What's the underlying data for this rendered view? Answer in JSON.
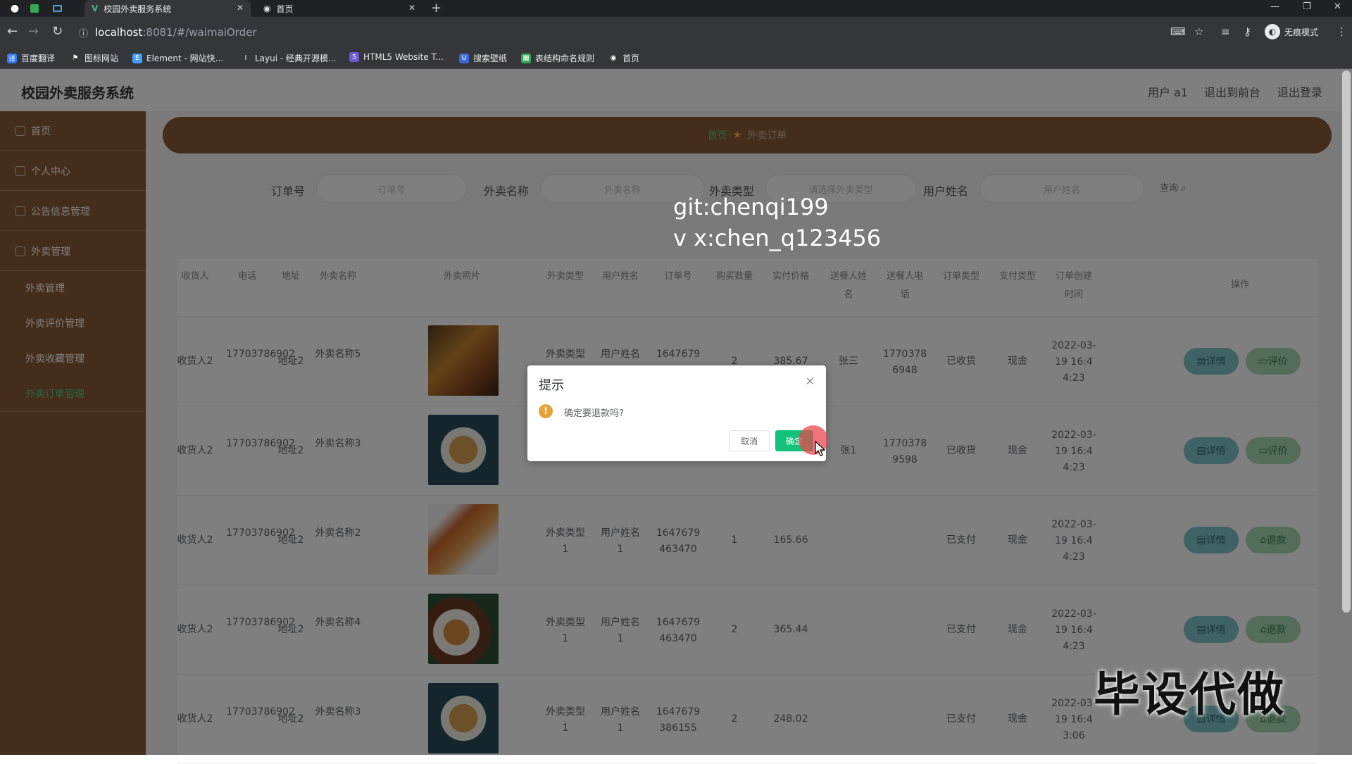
{
  "browser": {
    "tabs": [
      {
        "title": "校园外卖服务系统",
        "active": true
      },
      {
        "title": "首页",
        "active": false
      }
    ],
    "url_host": "localhost",
    "url_path": ":8081/#/waimaiOrder",
    "incognito_label": "无痕模式",
    "bookmarks": [
      "百度翻译",
      "图标网站",
      "Element - 网站快...",
      "Layui - 经典开源模...",
      "HTML5 Website T...",
      "搜索壁纸",
      "表结构命名规则",
      "首页"
    ]
  },
  "app": {
    "title": "校园外卖服务系统",
    "header_links": [
      "用户 a1",
      "退出到前台",
      "退出登录"
    ]
  },
  "sidebar": {
    "items": [
      "首页",
      "个人中心",
      "公告信息管理",
      "外卖管理"
    ],
    "subitems": [
      "外卖管理",
      "外卖评价管理",
      "外卖收藏管理",
      "外卖订单管理"
    ]
  },
  "breadcrumb": {
    "home": "首页",
    "current": "外卖订单"
  },
  "search": {
    "labels": [
      "订单号",
      "外卖名称",
      "外卖类型",
      "用户姓名"
    ],
    "placeholders": [
      "订单号",
      "外卖名称",
      "请选择外卖类型",
      "用户姓名"
    ],
    "button": "查询"
  },
  "table": {
    "headers": [
      "收货人",
      "电话",
      "地址",
      "外卖名称",
      "外卖照片",
      "外卖类型",
      "用户姓名",
      "订单号",
      "购买数量",
      "实付价格",
      "送餐人姓名",
      "送餐人电话",
      "订单类型",
      "支付类型",
      "订单创建时间",
      "操作"
    ],
    "rows": [
      {
        "receiver": "收货人2",
        "phone": "17703786902",
        "address": "地址2",
        "name": "外卖名称5",
        "type": "外卖类型1",
        "user": "用户姓名1",
        "order_no": "1647679463470",
        "qty": "2",
        "price": "385.67",
        "courier": "张三",
        "courier_phone": "17703786948",
        "status": "已收货",
        "pay": "现金",
        "time": "2022-03-19 16:44:23",
        "action": "评价"
      },
      {
        "receiver": "收货人2",
        "phone": "17703786902",
        "address": "地址2",
        "name": "外卖名称3",
        "type": "",
        "user": "",
        "order_no": "",
        "qty": "",
        "price": "",
        "courier": "张1",
        "courier_phone": "17703789598",
        "status": "已收货",
        "pay": "现金",
        "time": "2022-03-19 16:44:23",
        "action": "评价"
      },
      {
        "receiver": "收货人2",
        "phone": "17703786902",
        "address": "地址2",
        "name": "外卖名称2",
        "type": "外卖类型1",
        "user": "用户姓名1",
        "order_no": "1647679463470",
        "qty": "1",
        "price": "165.66",
        "courier": "",
        "courier_phone": "",
        "status": "已支付",
        "pay": "现金",
        "time": "2022-03-19 16:44:23",
        "action": "退款"
      },
      {
        "receiver": "收货人2",
        "phone": "17703786902",
        "address": "地址2",
        "name": "外卖名称4",
        "type": "外卖类型1",
        "user": "用户姓名1",
        "order_no": "1647679463470",
        "qty": "2",
        "price": "365.44",
        "courier": "",
        "courier_phone": "",
        "status": "已支付",
        "pay": "现金",
        "time": "2022-03-19 16:44:23",
        "action": "退款"
      },
      {
        "receiver": "收货人2",
        "phone": "17703786902",
        "address": "地址2",
        "name": "外卖名称3",
        "type": "外卖类型1",
        "user": "用户姓名1",
        "order_no": "1647679386155",
        "qty": "2",
        "price": "248.02",
        "courier": "",
        "courier_phone": "",
        "status": "已支付",
        "pay": "现金",
        "time": "2022-03-19 16:43:06",
        "action": "退款"
      }
    ],
    "detail_label": "详情"
  },
  "dialog": {
    "title": "提示",
    "message": "确定要退款吗?",
    "cancel": "取消",
    "confirm": "确定"
  },
  "overlay": {
    "line1": "git:chenqi199",
    "line2": "v x:chen_q123456",
    "corner": "毕设代做"
  },
  "colors": {
    "sidebar": "#8a5a37",
    "accent_green": "#13c27a",
    "detail_button": "#7fc4c9",
    "action_button": "#a9d9b5"
  }
}
